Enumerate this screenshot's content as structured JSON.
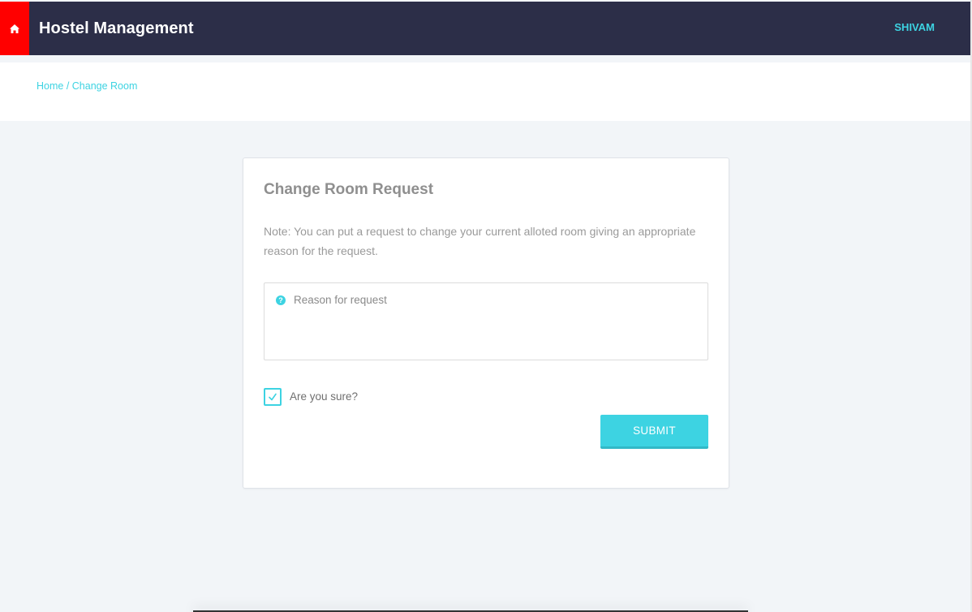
{
  "header": {
    "home_icon": "home-icon",
    "title": "Hostel Management",
    "user_name": "SHIVAM"
  },
  "breadcrumb": {
    "home": "Home",
    "separator": " / ",
    "current": "Change Room"
  },
  "form": {
    "title": "Change Room Request",
    "note": "Note: You can put a request to change your current alloted room giving an appropriate reason for the request.",
    "reason_icon": "question-circle-icon",
    "reason_placeholder": "Reason for request",
    "reason_value": "",
    "confirm_label": "Are you sure?",
    "confirm_checked": true,
    "submit_label": "SUBMIT"
  },
  "colors": {
    "accent": "#3dd3e2",
    "topbar": "#2c2e48",
    "home_button": "#ff0000",
    "background": "#f2f5f8"
  }
}
